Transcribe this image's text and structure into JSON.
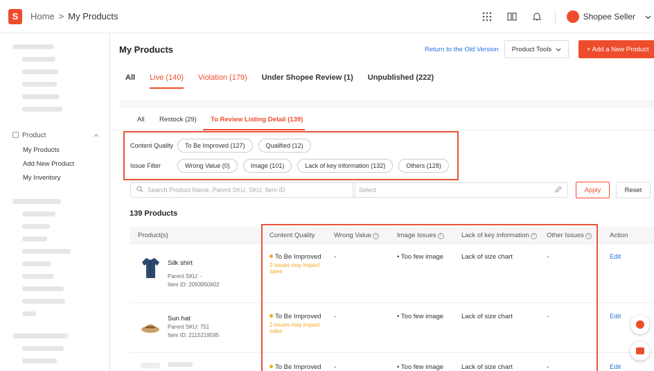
{
  "topbar": {
    "logo_letter": "S",
    "breadcrumb_home": "Home",
    "breadcrumb_sep": ">",
    "breadcrumb_current": "My Products",
    "seller_name": "Shopee Seller"
  },
  "sidebar": {
    "product_section": "Product",
    "items": [
      "My Products",
      "Add New Product",
      "My Inventory"
    ]
  },
  "header": {
    "title": "My Products",
    "old_version_link": "Return to the Old Version",
    "product_tools": "Product Tools",
    "add_new": "+ Add a New Product"
  },
  "tabs": {
    "all": "All",
    "live": "Live (140)",
    "violation": "Violation (179)",
    "review": "Under Shopee Review (1)",
    "unpublished": "Unpublished (222)"
  },
  "subtabs": {
    "all": "All",
    "restock": "Restock (29)",
    "review_listing": "To Review Listing Detail (139)"
  },
  "filters": {
    "content_quality_label": "Content Quality",
    "content_quality_chips": [
      "To Be Improved (127)",
      "Qualified (12)"
    ],
    "issue_filter_label": "Issue Filter",
    "issue_chips": [
      "Wrong Value (0)",
      "Image (101)",
      "Lack of key information (132)",
      "Others (128)"
    ]
  },
  "search": {
    "placeholder": "Search Product Name, Parent SKU, SKU, Item ID",
    "select_placeholder": "Select",
    "apply": "Apply",
    "reset": "Reset"
  },
  "products_count": "139 Products",
  "table": {
    "headers": [
      "Product(s)",
      "Content Quality",
      "Wrong Value",
      "Image Issues",
      "Lack of key information",
      "Other Issues",
      "Action"
    ],
    "rows": [
      {
        "name": "Silk shirt",
        "parent_sku": "Parent SKU: -",
        "item_id": "Item ID: 2093950602",
        "quality": "To Be Improved",
        "quality_note": "2 issues may impact sales",
        "wrong_value": "-",
        "image_issue": "• Too few image",
        "lack_info": "Lack of size chart",
        "other": "-",
        "action": "Edit"
      },
      {
        "name": "Sun hat",
        "parent_sku": "Parent SKU: 751",
        "item_id": "Item ID: 2115219595",
        "quality": "To Be Improved",
        "quality_note": "2 issues may impact sales",
        "wrong_value": "-",
        "image_issue": "• Too few image",
        "lack_info": "Lack of size chart",
        "other": "-",
        "action": "Edit"
      },
      {
        "quality": "To Be Improved",
        "wrong_value": "-",
        "image_issue": "• Too few image",
        "lack_info": "Lack of size chart",
        "other": "-",
        "action": "Edit"
      }
    ]
  },
  "colors": {
    "brand": "#ee4d2d",
    "link": "#2673dd",
    "warning": "#f5a623",
    "highlight_box": "#e8523a"
  }
}
